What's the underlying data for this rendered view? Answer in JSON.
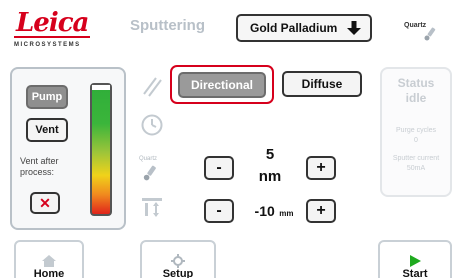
{
  "header": {
    "brand": "Leica",
    "brand_sub": "MICROSYSTEMS",
    "sputtering_label": "Sputtering",
    "target_select": {
      "selected": "Gold Palladium"
    },
    "quartz_label": "Quartz"
  },
  "left_panel": {
    "pump_label": "Pump",
    "vent_label": "Vent",
    "vent_after_label_1": "Vent after",
    "vent_after_label_2": "process:",
    "vent_after_value": "✕"
  },
  "mode": {
    "directional_label": "Directional",
    "diffuse_label": "Diffuse",
    "selected": "Directional"
  },
  "thickness": {
    "value": "5",
    "unit": "nm",
    "minus": "-",
    "plus": "+"
  },
  "height": {
    "value": "-10",
    "unit": "mm",
    "minus": "-",
    "plus": "+"
  },
  "middle_icons": {
    "quartz_label": "Quartz"
  },
  "status": {
    "title": "Status",
    "state": "idle",
    "purge_label": "Purge cycles",
    "purge_value": "0",
    "current_label": "Sputter current",
    "current_value": "50mA"
  },
  "nav": {
    "home": "Home",
    "setup": "Setup",
    "start": "Start"
  },
  "colors": {
    "brand_red": "#d6001c",
    "start_green": "#1faa1f",
    "panel_border": "#b9c1c8"
  }
}
